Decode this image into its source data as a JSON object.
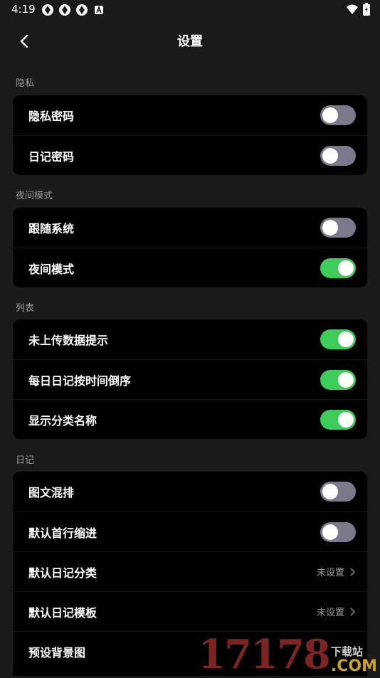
{
  "status_bar": {
    "time": "4:19",
    "icons_left": [
      "app-icon",
      "app-icon",
      "app-icon",
      "a-badge-icon"
    ],
    "icons_right": [
      "wifi-icon",
      "battery-charging-icon"
    ]
  },
  "nav": {
    "title": "设置",
    "back_icon": "chevron-left-icon"
  },
  "sections": {
    "privacy": {
      "label": "隐私",
      "rows": [
        {
          "label": "隐私密码",
          "type": "toggle",
          "on": false
        },
        {
          "label": "日记密码",
          "type": "toggle",
          "on": false
        }
      ]
    },
    "night": {
      "label": "夜间模式",
      "rows": [
        {
          "label": "跟随系统",
          "type": "toggle",
          "on": false
        },
        {
          "label": "夜间模式",
          "type": "toggle",
          "on": true
        }
      ]
    },
    "list": {
      "label": "列表",
      "rows": [
        {
          "label": "未上传数据提示",
          "type": "toggle",
          "on": true
        },
        {
          "label": "每日日记按时间倒序",
          "type": "toggle",
          "on": true
        },
        {
          "label": "显示分类名称",
          "type": "toggle",
          "on": true
        }
      ]
    },
    "diary": {
      "label": "日记",
      "rows": [
        {
          "label": "图文混排",
          "type": "toggle",
          "on": false
        },
        {
          "label": "默认首行缩进",
          "type": "toggle",
          "on": false
        },
        {
          "label": "默认日记分类",
          "type": "link",
          "value": "未设置"
        },
        {
          "label": "默认日记模板",
          "type": "link",
          "value": "未设置"
        },
        {
          "label": "预设背景图",
          "type": "link",
          "value": ""
        }
      ]
    }
  },
  "watermark": {
    "number": "17178",
    "cn": "下载站",
    "com": ".COM"
  },
  "colors": {
    "background": "#1a1a1a",
    "card": "#000000",
    "toggle_on": "#3dcc5a",
    "toggle_off": "#7a7a8c",
    "secondary_text": "#9a9a9a"
  }
}
